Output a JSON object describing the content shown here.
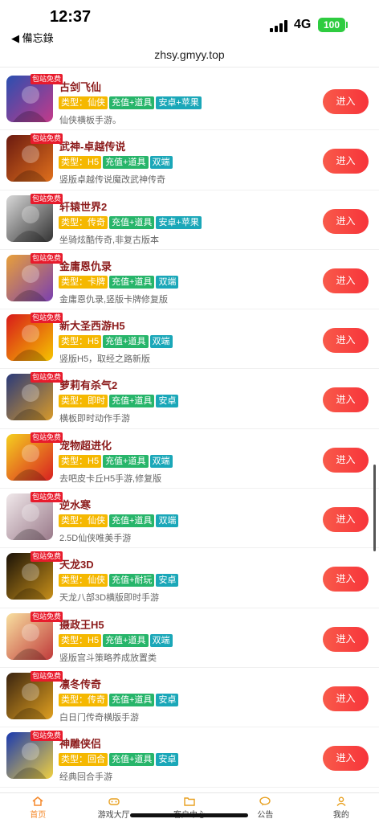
{
  "status": {
    "time": "12:37",
    "back_app": "◀ 備忘錄",
    "network": "4G",
    "battery": "100"
  },
  "url": "zhsy.gmyy.top",
  "badge_text": "包站免费",
  "enter_label": "进入",
  "games": [
    {
      "name": "古剑飞仙",
      "type": "类型：仙侠",
      "pay": "充值+道具",
      "platform": "安卓+苹果",
      "desc": "仙侠横板手游。",
      "c1": "#2a4fb0",
      "c2": "#c43a8a"
    },
    {
      "name": "武神-卓越传说",
      "type": "类型：H5",
      "pay": "充值+道具",
      "platform": "双端",
      "desc": "竖版卓越传说魔改武神传奇",
      "c1": "#6b1a10",
      "c2": "#e0701c"
    },
    {
      "name": "轩辕世界2",
      "type": "类型：传奇",
      "pay": "充值+道具",
      "platform": "安卓+苹果",
      "desc": "坐骑炫酷传奇,非复古版本",
      "c1": "#d8d8d8",
      "c2": "#333333"
    },
    {
      "name": "金庸恩仇录",
      "type": "类型：卡牌",
      "pay": "充值+道具",
      "platform": "双端",
      "desc": "金庸恩仇录,竖版卡牌修复版",
      "c1": "#e8a03a",
      "c2": "#7a3fb0"
    },
    {
      "name": "新大圣西游H5",
      "type": "类型：H5",
      "pay": "充值+道具",
      "platform": "双端",
      "desc": "竖版H5，取经之路新版",
      "c1": "#d81a1a",
      "c2": "#f5c400"
    },
    {
      "name": "萝莉有杀气2",
      "type": "类型：即时",
      "pay": "充值+道具",
      "platform": "安卓",
      "desc": "横板即时动作手游",
      "c1": "#2a3a7a",
      "c2": "#d89a2a"
    },
    {
      "name": "宠物超进化",
      "type": "类型：H5",
      "pay": "充值+道具",
      "platform": "双端",
      "desc": "去吧皮卡丘H5手游,修复版",
      "c1": "#f5d020",
      "c2": "#d82020"
    },
    {
      "name": "逆水寒",
      "type": "类型：仙侠",
      "pay": "充值+道具",
      "platform": "双端",
      "desc": "2.5D仙侠唯美手游",
      "c1": "#f0e8ea",
      "c2": "#9a7a8a"
    },
    {
      "name": "天龙3D",
      "type": "类型：仙侠",
      "pay": "充值+耐玩",
      "platform": "安卓",
      "desc": "天龙八部3D横版即时手游",
      "c1": "#1a1208",
      "c2": "#c8901a"
    },
    {
      "name": "摄政王H5",
      "type": "类型：H5",
      "pay": "充值+道具",
      "platform": "双端",
      "desc": "竖版宫斗策略养成放置类",
      "c1": "#f8e0a0",
      "c2": "#c03a3a"
    },
    {
      "name": "凛冬传奇",
      "type": "类型：传奇",
      "pay": "充值+道具",
      "platform": "安卓",
      "desc": "白日门传奇横版手游",
      "c1": "#3a2410",
      "c2": "#e0a020"
    },
    {
      "name": "神雕侠侣",
      "type": "类型：回合",
      "pay": "充值+道具",
      "platform": "安卓",
      "desc": "经典回合手游",
      "c1": "#1a3ab0",
      "c2": "#f0d040"
    }
  ],
  "tabs": [
    {
      "label": "首页",
      "icon": "home-icon"
    },
    {
      "label": "游戏大厅",
      "icon": "gamepad-icon"
    },
    {
      "label": "客户中心",
      "icon": "folder-icon"
    },
    {
      "label": "公告",
      "icon": "chat-icon"
    },
    {
      "label": "我的",
      "icon": "user-icon"
    }
  ],
  "colors": {
    "accent": "#f7343a",
    "active_tab": "#f5892b",
    "type_tag": "#f5b800",
    "pay_tag": "#27b56a",
    "platform_tag": "#1aa7b8",
    "name": "#8b1a1a"
  }
}
